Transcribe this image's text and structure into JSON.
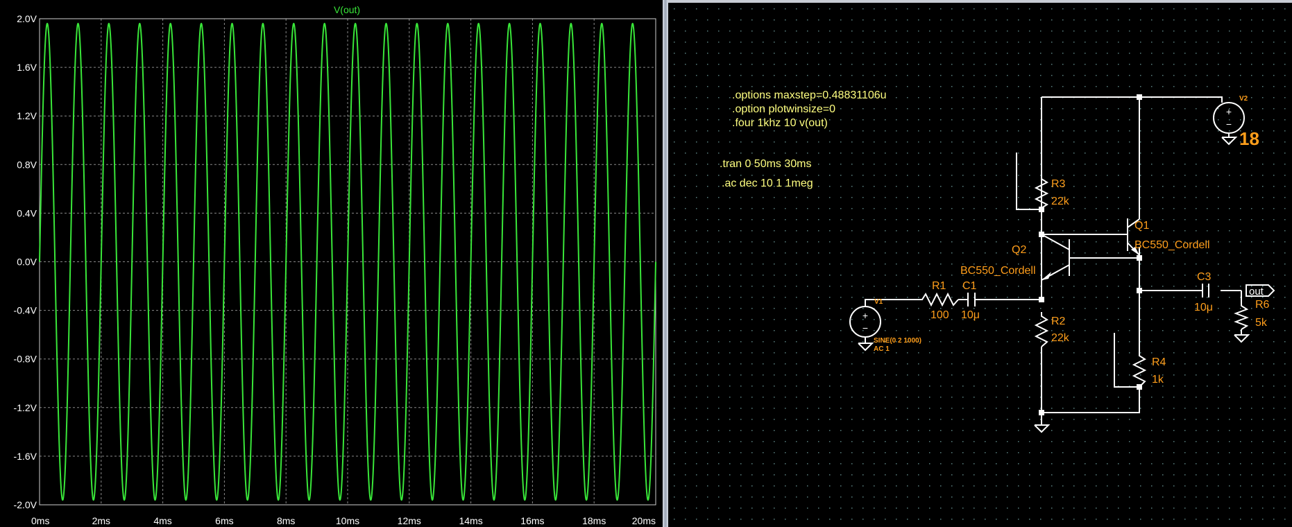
{
  "plot": {
    "trace_name": "V(out)",
    "colors": {
      "trace": "#39e639",
      "grid": "#8a8a8a",
      "frame": "#d0d0d0",
      "title": "#39e639"
    }
  },
  "chart_data": {
    "type": "line",
    "title": "V(out)",
    "xlabel": "",
    "ylabel": "",
    "xlim": [
      0,
      20
    ],
    "ylim": [
      -2.0,
      2.0
    ],
    "x_ticks": [
      "0ms",
      "2ms",
      "4ms",
      "6ms",
      "8ms",
      "10ms",
      "12ms",
      "14ms",
      "16ms",
      "18ms",
      "20ms"
    ],
    "y_ticks": [
      "2.0V",
      "1.6V",
      "1.2V",
      "0.8V",
      "0.4V",
      "0.0V",
      "-0.4V",
      "-0.8V",
      "-1.2V",
      "-1.6V",
      "-2.0V"
    ],
    "grid": true,
    "series": [
      {
        "name": "V(out)",
        "waveform": "sine",
        "amplitude": 1.96,
        "offset": 0.0,
        "frequency_khz": 1.0,
        "x_unit": "ms",
        "y_unit": "V"
      }
    ]
  },
  "schematic": {
    "directives": [
      ".options maxstep=0.48831106u",
      ".option plotwinsize=0",
      ".four 1khz 10 v(out)",
      ".tran 0 50ms 30ms",
      ".ac dec 10 1 1meg"
    ],
    "components": {
      "r3": {
        "name": "R3",
        "value": "22k"
      },
      "r2": {
        "name": "R2",
        "value": "22k"
      },
      "r1": {
        "name": "R1",
        "value": "100"
      },
      "c1": {
        "name": "C1",
        "value": "10μ"
      },
      "c3": {
        "name": "C3",
        "value": "10μ"
      },
      "r4": {
        "name": "R4",
        "value": "1k"
      },
      "r6": {
        "name": "R6",
        "value": "5k"
      },
      "q1": {
        "name": "Q1",
        "model": "BC550_Cordell"
      },
      "q2": {
        "name": "Q2",
        "model": "BC550_Cordell"
      },
      "v1": {
        "name": "V1",
        "value_line1": "SINE(0 2 1000)",
        "value_line2": "AC 1"
      },
      "v2": {
        "name": "V2",
        "value": "18"
      }
    },
    "net_label_out": "out",
    "colors": {
      "background": "#000000",
      "wire": "#ffffff",
      "grid_dot": "#5a7f7f",
      "component_text": "#ff9e1b",
      "directive_text": "#ffff80"
    }
  }
}
